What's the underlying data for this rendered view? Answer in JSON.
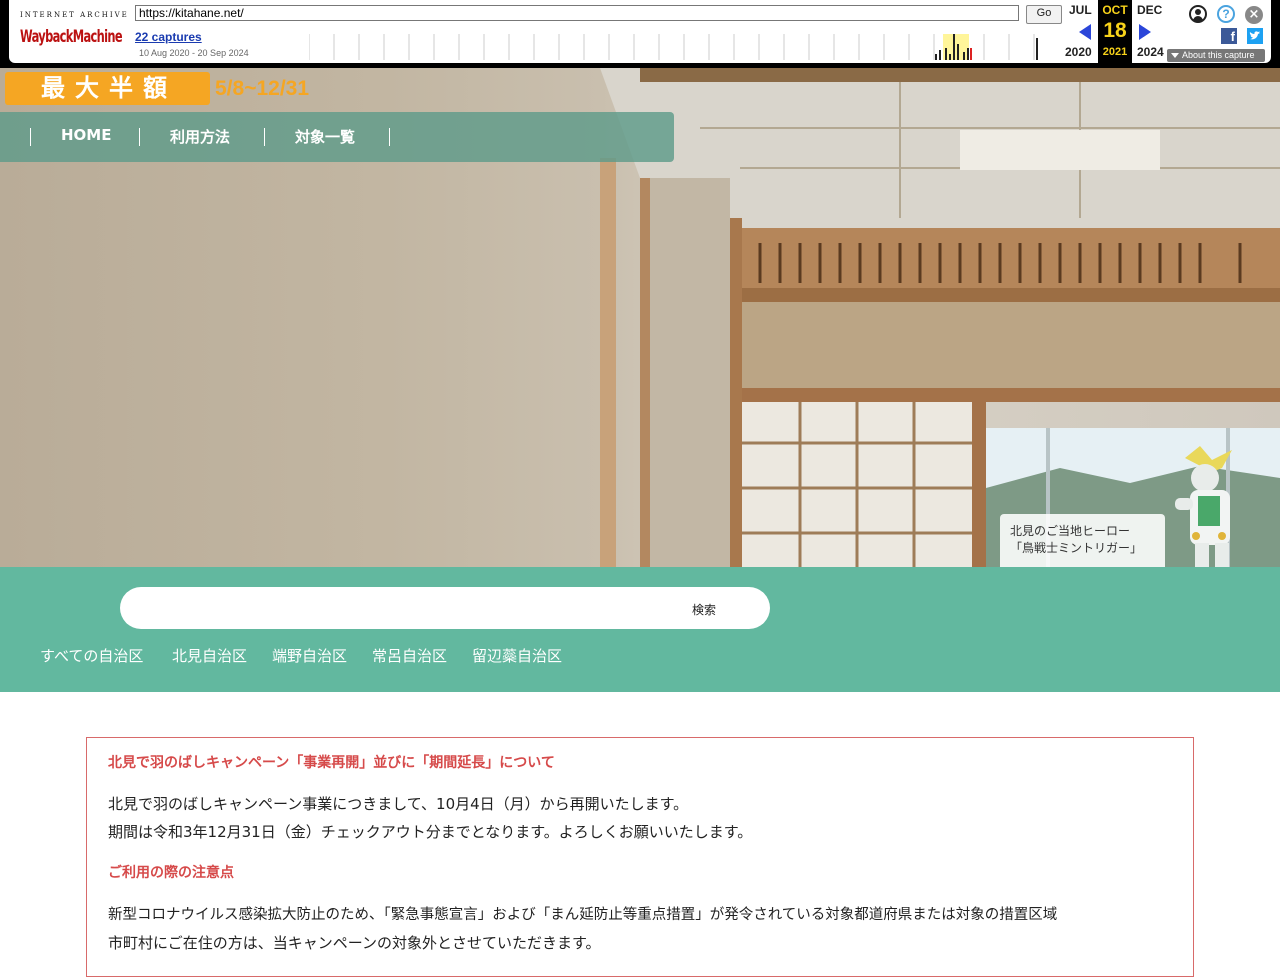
{
  "wayback": {
    "logo_top": "INTERNET ARCHIVE",
    "logo_main": "WaybackMachine",
    "url": "https://kitahane.net/",
    "go_label": "Go",
    "captures": "22 captures",
    "range": "10 Aug 2020 - 20 Sep 2024",
    "prev_month": "JUL",
    "prev_year": "2020",
    "cur_month": "OCT",
    "cur_day": "18",
    "cur_year": "2021",
    "next_month": "DEC",
    "next_year": "2024",
    "about": "About this capture",
    "colors": {
      "accent": "#f7d21a",
      "link": "#1a3bb0",
      "arrow": "#2b46d9"
    }
  },
  "banner": {
    "label": "最大半額",
    "dates": "5/8~12/31",
    "color": "#f5a623"
  },
  "nav": {
    "items": [
      {
        "label": "HOME"
      },
      {
        "label": "利用方法"
      },
      {
        "label": "対象一覧"
      }
    ]
  },
  "hero": {
    "caption_line1": "北見のご当地ヒーロー",
    "caption_line2": "「鳥戦士ミントリガー」"
  },
  "search": {
    "button": "検索",
    "placeholder": "",
    "regions": [
      "すべての自治区",
      "北見自治区",
      "端野自治区",
      "常呂自治区",
      "留辺蘂自治区"
    ],
    "band_color": "#62b89f"
  },
  "notice": {
    "heading1": "北見で羽のばしキャンペーン「事業再開」並びに「期間延長」について",
    "para1_line1": "北見で羽のばしキャンペーン事業につきまして、10月4日（月）から再開いたします。",
    "para1_line2": "期間は令和3年12月31日（金）チェックアウト分までとなります。よろしくお願いいたします。",
    "heading2": "ご利用の際の注意点",
    "para2_line1": "新型コロナウイルス感染拡大防止のため、「緊急事態宣言」および「まん延防止等重点措置」が発令されている対象都道府県または対象の措置区域",
    "para2_line2": "市町村にご在住の方は、当キャンペーンの対象外とさせていただきます。",
    "border_color": "#d86a6a"
  }
}
